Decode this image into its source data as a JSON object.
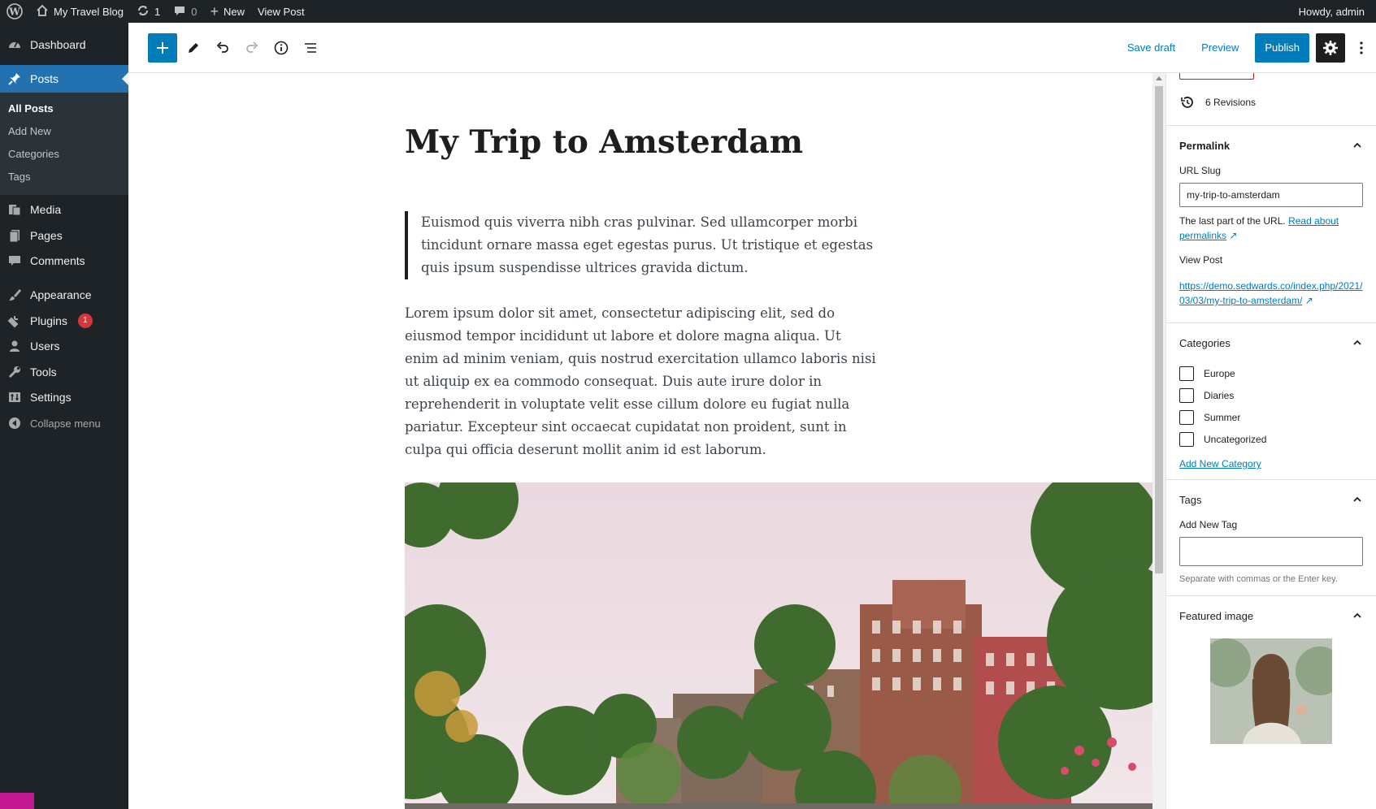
{
  "adminbar": {
    "site_name": "My Travel Blog",
    "updates_count": "1",
    "comments_count": "0",
    "new_label": "New",
    "view_post": "View Post",
    "howdy": "Howdy, admin"
  },
  "sidebar": {
    "dashboard": "Dashboard",
    "posts": "Posts",
    "submenu": [
      "All Posts",
      "Add New",
      "Categories",
      "Tags"
    ],
    "media": "Media",
    "pages": "Pages",
    "comments": "Comments",
    "appearance": "Appearance",
    "plugins": "Plugins",
    "plugins_badge": "1",
    "users": "Users",
    "tools": "Tools",
    "settings": "Settings",
    "collapse": "Collapse menu"
  },
  "toolbar": {
    "save_draft": "Save draft",
    "preview": "Preview",
    "publish": "Publish"
  },
  "post": {
    "title": "My Trip to Amsterdam",
    "quote": "Euismod quis viverra nibh cras pulvinar. Sed ullamcorper morbi tincidunt ornare massa eget egestas purus. Ut tristique et egestas quis ipsum suspendisse ultrices gravida dictum.",
    "paragraph": "Lorem ipsum dolor sit amet, consectetur adipiscing elit, sed do eiusmod tempor incididunt ut labore et dolore magna aliqua. Ut enim ad minim veniam, quis nostrud exercitation ullamco laboris nisi ut aliquip ex ea commodo consequat. Duis aute irure dolor in reprehenderit in voluptate velit esse cillum dolore eu fugiat nulla pariatur. Excepteur sint occaecat cupidatat non proident, sunt in culpa qui officia deserunt mollit anim id est laborum."
  },
  "panel": {
    "revisions": "6 Revisions",
    "permalink": {
      "title": "Permalink",
      "slug_label": "URL Slug",
      "slug_value": "my-trip-to-amsterdam",
      "help_text": "The last part of the URL.",
      "help_link": "Read about permalinks",
      "view_post_label": "View Post",
      "url": "https://demo.sedwards.co/index.php/2021/03/03/my-trip-to-amsterdam/"
    },
    "categories": {
      "title": "Categories",
      "items": [
        "Europe",
        "Diaries",
        "Summer",
        "Uncategorized"
      ],
      "add_new": "Add New Category"
    },
    "tags": {
      "title": "Tags",
      "add_label": "Add New Tag",
      "input_value": "",
      "help": "Separate with commas or the Enter key."
    },
    "featured": {
      "title": "Featured image"
    }
  }
}
